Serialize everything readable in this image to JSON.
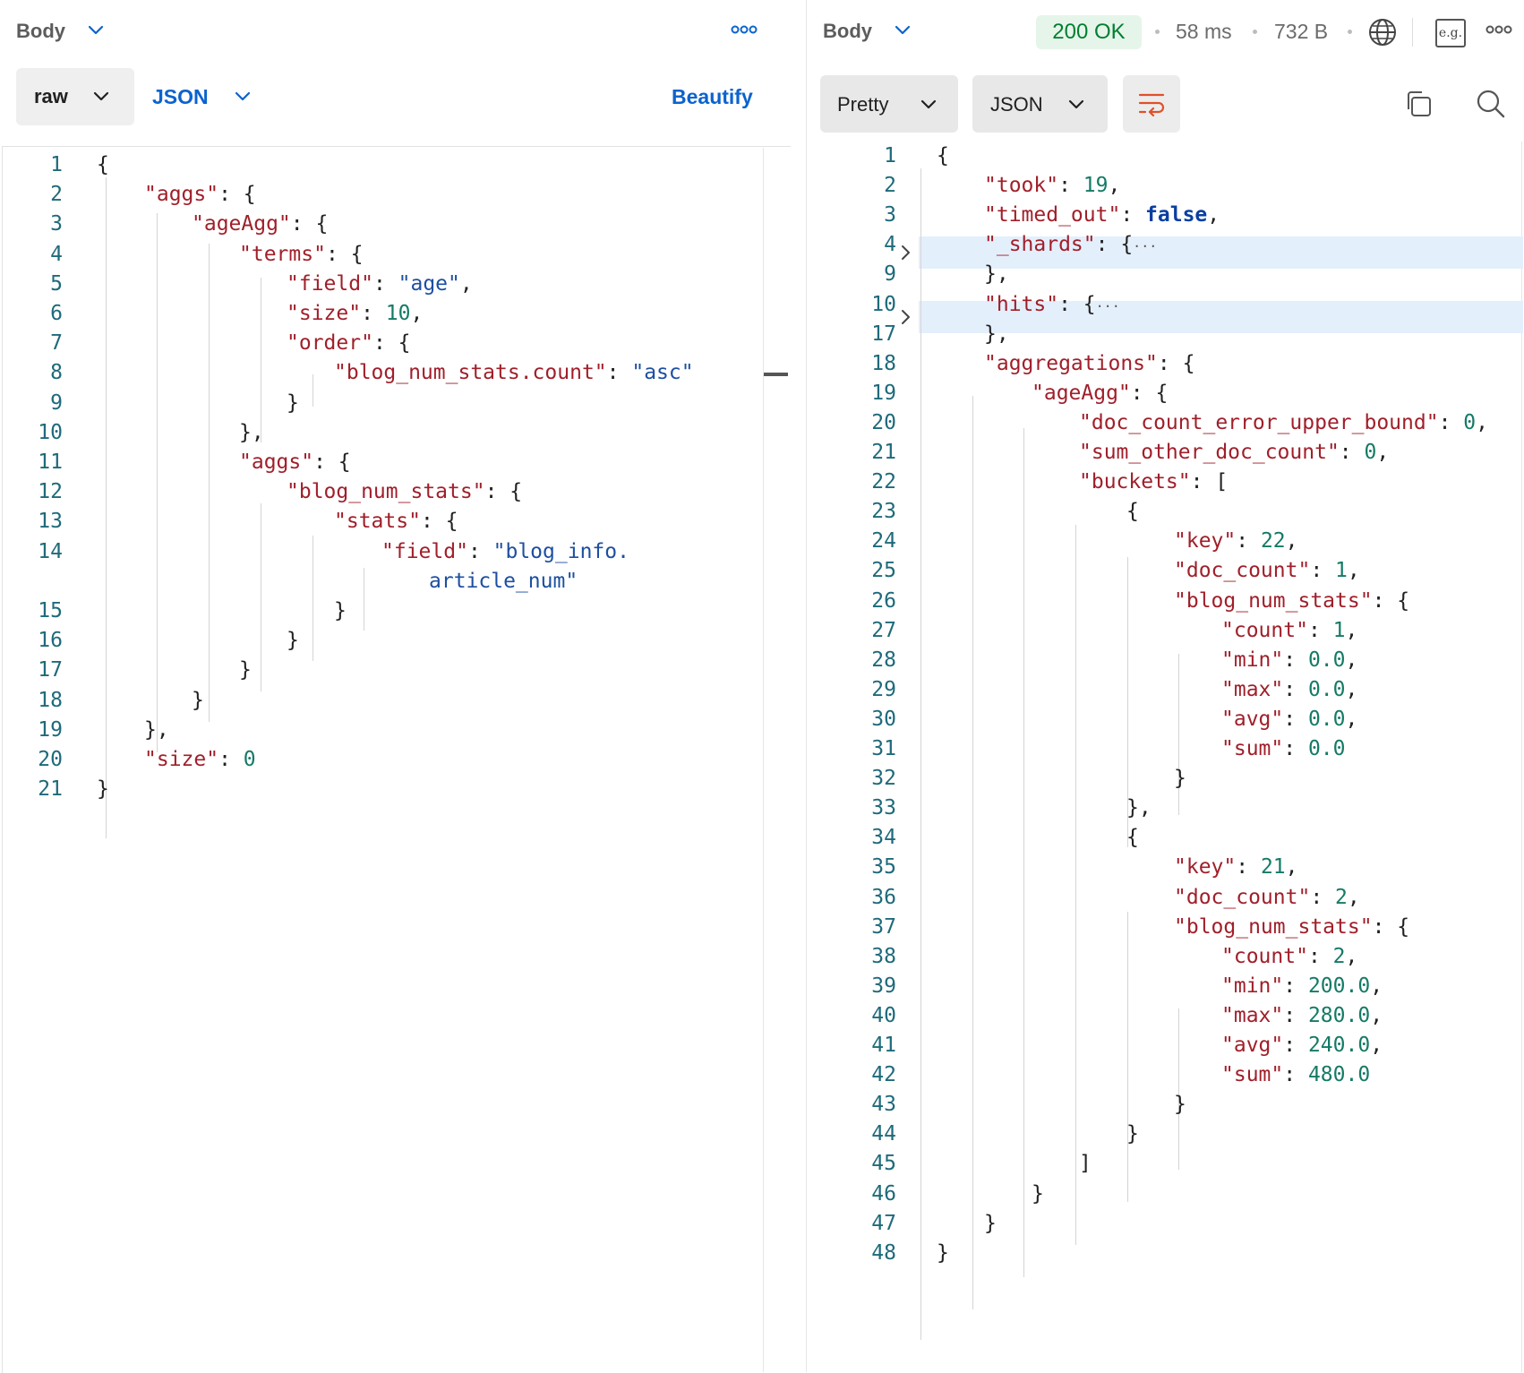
{
  "request": {
    "header": {
      "label": "Body"
    },
    "mode": "raw",
    "language": "JSON",
    "beautify": "Beautify",
    "lines": [
      {
        "n": "1",
        "t": [
          [
            "p",
            "{"
          ]
        ]
      },
      {
        "n": "2",
        "t": [
          [
            "k",
            "\"aggs\""
          ],
          [
            "p",
            ": {"
          ]
        ]
      },
      {
        "n": "3",
        "t": [
          [
            "k",
            "\"ageAgg\""
          ],
          [
            "p",
            ": {"
          ]
        ]
      },
      {
        "n": "4",
        "t": [
          [
            "k",
            "\"terms\""
          ],
          [
            "p",
            ": {"
          ]
        ]
      },
      {
        "n": "5",
        "t": [
          [
            "k",
            "\"field\""
          ],
          [
            "p",
            ": "
          ],
          [
            "s",
            "\"age\""
          ],
          [
            "p",
            ","
          ]
        ]
      },
      {
        "n": "6",
        "t": [
          [
            "k",
            "\"size\""
          ],
          [
            "p",
            ": "
          ],
          [
            "n",
            "10"
          ],
          [
            "p",
            ","
          ]
        ]
      },
      {
        "n": "7",
        "t": [
          [
            "k",
            "\"order\""
          ],
          [
            "p",
            ": {"
          ]
        ]
      },
      {
        "n": "8",
        "t": [
          [
            "k",
            "\"blog_num_stats.count\""
          ],
          [
            "p",
            ": "
          ],
          [
            "s",
            "\"asc\""
          ]
        ]
      },
      {
        "n": "9",
        "t": [
          [
            "p",
            "}"
          ]
        ]
      },
      {
        "n": "10",
        "t": [
          [
            "p",
            "},"
          ]
        ]
      },
      {
        "n": "11",
        "t": [
          [
            "k",
            "\"aggs\""
          ],
          [
            "p",
            ": {"
          ]
        ]
      },
      {
        "n": "12",
        "t": [
          [
            "k",
            "\"blog_num_stats\""
          ],
          [
            "p",
            ": {"
          ]
        ]
      },
      {
        "n": "13",
        "t": [
          [
            "k",
            "\"stats\""
          ],
          [
            "p",
            ": {"
          ]
        ]
      },
      {
        "n": "14",
        "t": [
          [
            "k",
            "\"field\""
          ],
          [
            "p",
            ": "
          ],
          [
            "s",
            "\"blog_info."
          ]
        ]
      },
      {
        "n": "",
        "t": [
          [
            "s",
            "article_num\""
          ]
        ]
      },
      {
        "n": "15",
        "t": [
          [
            "p",
            "}"
          ]
        ]
      },
      {
        "n": "16",
        "t": [
          [
            "p",
            "}"
          ]
        ]
      },
      {
        "n": "17",
        "t": [
          [
            "p",
            "}"
          ]
        ]
      },
      {
        "n": "18",
        "t": [
          [
            "p",
            "}"
          ]
        ]
      },
      {
        "n": "19",
        "t": [
          [
            "p",
            "},"
          ]
        ]
      },
      {
        "n": "20",
        "t": [
          [
            "k",
            "\"size\""
          ],
          [
            "p",
            ": "
          ],
          [
            "n",
            "0"
          ]
        ]
      },
      {
        "n": "21",
        "t": [
          [
            "p",
            "}"
          ]
        ]
      }
    ]
  },
  "response": {
    "header": {
      "label": "Body"
    },
    "status": "200 OK",
    "time": "58 ms",
    "size": "732 B",
    "example_icon_text": "e.g.",
    "view": "Pretty",
    "language": "JSON",
    "lines": [
      {
        "n": "1",
        "t": [
          [
            "p",
            "{"
          ]
        ]
      },
      {
        "n": "2",
        "t": [
          [
            "k",
            "\"took\""
          ],
          [
            "p",
            ": "
          ],
          [
            "n",
            "19"
          ],
          [
            "p",
            ","
          ]
        ]
      },
      {
        "n": "3",
        "t": [
          [
            "k",
            "\"timed_out\""
          ],
          [
            "p",
            ": "
          ],
          [
            "b",
            "false"
          ],
          [
            "p",
            ","
          ]
        ]
      },
      {
        "n": "4",
        "t": [
          [
            "k",
            "\"_shards\""
          ],
          [
            "p",
            ": {"
          ],
          [
            "p",
            "···"
          ]
        ]
      },
      {
        "n": "9",
        "t": [
          [
            "p",
            "},"
          ]
        ]
      },
      {
        "n": "10",
        "t": [
          [
            "k",
            "\"hits\""
          ],
          [
            "p",
            ": {"
          ],
          [
            "p",
            "···"
          ]
        ]
      },
      {
        "n": "17",
        "t": [
          [
            "p",
            "},"
          ]
        ]
      },
      {
        "n": "18",
        "t": [
          [
            "k",
            "\"aggregations\""
          ],
          [
            "p",
            ": {"
          ]
        ]
      },
      {
        "n": "19",
        "t": [
          [
            "k",
            "\"ageAgg\""
          ],
          [
            "p",
            ": {"
          ]
        ]
      },
      {
        "n": "20",
        "t": [
          [
            "k",
            "\"doc_count_error_upper_bound\""
          ],
          [
            "p",
            ": "
          ],
          [
            "n",
            "0"
          ],
          [
            "p",
            ","
          ]
        ]
      },
      {
        "n": "21",
        "t": [
          [
            "k",
            "\"sum_other_doc_count\""
          ],
          [
            "p",
            ": "
          ],
          [
            "n",
            "0"
          ],
          [
            "p",
            ","
          ]
        ]
      },
      {
        "n": "22",
        "t": [
          [
            "k",
            "\"buckets\""
          ],
          [
            "p",
            ": ["
          ]
        ]
      },
      {
        "n": "23",
        "t": [
          [
            "p",
            "{"
          ]
        ]
      },
      {
        "n": "24",
        "t": [
          [
            "k",
            "\"key\""
          ],
          [
            "p",
            ": "
          ],
          [
            "n",
            "22"
          ],
          [
            "p",
            ","
          ]
        ]
      },
      {
        "n": "25",
        "t": [
          [
            "k",
            "\"doc_count\""
          ],
          [
            "p",
            ": "
          ],
          [
            "n",
            "1"
          ],
          [
            "p",
            ","
          ]
        ]
      },
      {
        "n": "26",
        "t": [
          [
            "k",
            "\"blog_num_stats\""
          ],
          [
            "p",
            ": {"
          ]
        ]
      },
      {
        "n": "27",
        "t": [
          [
            "k",
            "\"count\""
          ],
          [
            "p",
            ": "
          ],
          [
            "n",
            "1"
          ],
          [
            "p",
            ","
          ]
        ]
      },
      {
        "n": "28",
        "t": [
          [
            "k",
            "\"min\""
          ],
          [
            "p",
            ": "
          ],
          [
            "n",
            "0.0"
          ],
          [
            "p",
            ","
          ]
        ]
      },
      {
        "n": "29",
        "t": [
          [
            "k",
            "\"max\""
          ],
          [
            "p",
            ": "
          ],
          [
            "n",
            "0.0"
          ],
          [
            "p",
            ","
          ]
        ]
      },
      {
        "n": "30",
        "t": [
          [
            "k",
            "\"avg\""
          ],
          [
            "p",
            ": "
          ],
          [
            "n",
            "0.0"
          ],
          [
            "p",
            ","
          ]
        ]
      },
      {
        "n": "31",
        "t": [
          [
            "k",
            "\"sum\""
          ],
          [
            "p",
            ": "
          ],
          [
            "n",
            "0.0"
          ]
        ]
      },
      {
        "n": "32",
        "t": [
          [
            "p",
            "}"
          ]
        ]
      },
      {
        "n": "33",
        "t": [
          [
            "p",
            "},"
          ]
        ]
      },
      {
        "n": "34",
        "t": [
          [
            "p",
            "{"
          ]
        ]
      },
      {
        "n": "35",
        "t": [
          [
            "k",
            "\"key\""
          ],
          [
            "p",
            ": "
          ],
          [
            "n",
            "21"
          ],
          [
            "p",
            ","
          ]
        ]
      },
      {
        "n": "36",
        "t": [
          [
            "k",
            "\"doc_count\""
          ],
          [
            "p",
            ": "
          ],
          [
            "n",
            "2"
          ],
          [
            "p",
            ","
          ]
        ]
      },
      {
        "n": "37",
        "t": [
          [
            "k",
            "\"blog_num_stats\""
          ],
          [
            "p",
            ": {"
          ]
        ]
      },
      {
        "n": "38",
        "t": [
          [
            "k",
            "\"count\""
          ],
          [
            "p",
            ": "
          ],
          [
            "n",
            "2"
          ],
          [
            "p",
            ","
          ]
        ]
      },
      {
        "n": "39",
        "t": [
          [
            "k",
            "\"min\""
          ],
          [
            "p",
            ": "
          ],
          [
            "n",
            "200.0"
          ],
          [
            "p",
            ","
          ]
        ]
      },
      {
        "n": "40",
        "t": [
          [
            "k",
            "\"max\""
          ],
          [
            "p",
            ": "
          ],
          [
            "n",
            "280.0"
          ],
          [
            "p",
            ","
          ]
        ]
      },
      {
        "n": "41",
        "t": [
          [
            "k",
            "\"avg\""
          ],
          [
            "p",
            ": "
          ],
          [
            "n",
            "240.0"
          ],
          [
            "p",
            ","
          ]
        ]
      },
      {
        "n": "42",
        "t": [
          [
            "k",
            "\"sum\""
          ],
          [
            "p",
            ": "
          ],
          [
            "n",
            "480.0"
          ]
        ]
      },
      {
        "n": "43",
        "t": [
          [
            "p",
            "}"
          ]
        ]
      },
      {
        "n": "44",
        "t": [
          [
            "p",
            "}"
          ]
        ]
      },
      {
        "n": "45",
        "t": [
          [
            "p",
            "]"
          ]
        ]
      },
      {
        "n": "46",
        "t": [
          [
            "p",
            "}"
          ]
        ]
      },
      {
        "n": "47",
        "t": [
          [
            "p",
            "}"
          ]
        ]
      },
      {
        "n": "48",
        "t": [
          [
            "p",
            "}"
          ]
        ]
      }
    ]
  },
  "icons": {
    "more": "more-icon",
    "chevron": "chevron-down-icon",
    "globe": "globe-icon",
    "example": "example-icon",
    "wrap": "wrap-lines-icon",
    "copy": "copy-icon",
    "search": "search-icon",
    "fold": "chevron-right-icon"
  },
  "colors": {
    "key": "#a01f2a",
    "string": "#1d4fa0",
    "number": "#157a66",
    "boolean": "#0a3fa0",
    "link": "#0b63ce",
    "status_ok": "#007f31",
    "wrap_active": "#e0502a"
  }
}
